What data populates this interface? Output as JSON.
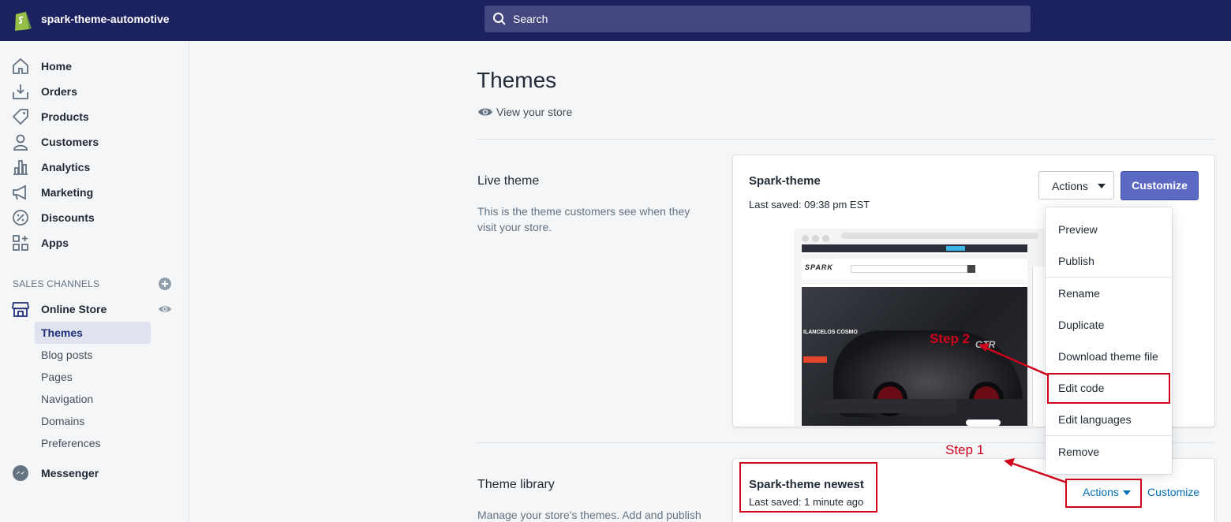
{
  "topbar": {
    "store_name": "spark-theme-automotive",
    "search_placeholder": "Search",
    "bg_color": "#1c2260"
  },
  "sidebar": {
    "items": [
      {
        "label": "Home",
        "icon": "home-icon"
      },
      {
        "label": "Orders",
        "icon": "orders-icon"
      },
      {
        "label": "Products",
        "icon": "tag-icon"
      },
      {
        "label": "Customers",
        "icon": "person-icon"
      },
      {
        "label": "Analytics",
        "icon": "bar-chart-icon"
      },
      {
        "label": "Marketing",
        "icon": "megaphone-icon"
      },
      {
        "label": "Discounts",
        "icon": "discount-icon"
      },
      {
        "label": "Apps",
        "icon": "apps-icon"
      }
    ],
    "sales_channels_title": "SALES CHANNELS",
    "online_store": "Online Store",
    "sub_items": [
      "Themes",
      "Blog posts",
      "Pages",
      "Navigation",
      "Domains",
      "Preferences"
    ],
    "active_sub": "Themes",
    "messenger": "Messenger"
  },
  "main": {
    "title": "Themes",
    "view_store": "View your store",
    "live": {
      "section_title": "Live theme",
      "section_desc": "This is the theme customers see when they visit your store.",
      "theme_name": "Spark-theme",
      "last_saved": "Last saved: 09:38 pm EST",
      "actions_label": "Actions",
      "customize_label": "Customize"
    },
    "library": {
      "section_title": "Theme library",
      "section_desc": "Manage your store's themes. Add and publish",
      "theme_name": "Spark-theme newest",
      "last_saved": "Last saved: 1 minute ago",
      "actions_label": "Actions",
      "customize_label": "Customize"
    }
  },
  "dropdown": {
    "items": [
      "Preview",
      "Publish",
      "Rename",
      "Duplicate",
      "Download theme file",
      "Edit code",
      "Edit languages",
      "Remove"
    ]
  },
  "annotations": {
    "step1": "Step 1",
    "step2": "Step 2",
    "color": "#d0021b"
  },
  "preview": {
    "logo_text": "SPARK",
    "hero_title": "ILANCELOS COSMO",
    "badge_text": "GTR"
  },
  "colors": {
    "primary_button": "#5c6ac4",
    "link": "#006fbb"
  }
}
